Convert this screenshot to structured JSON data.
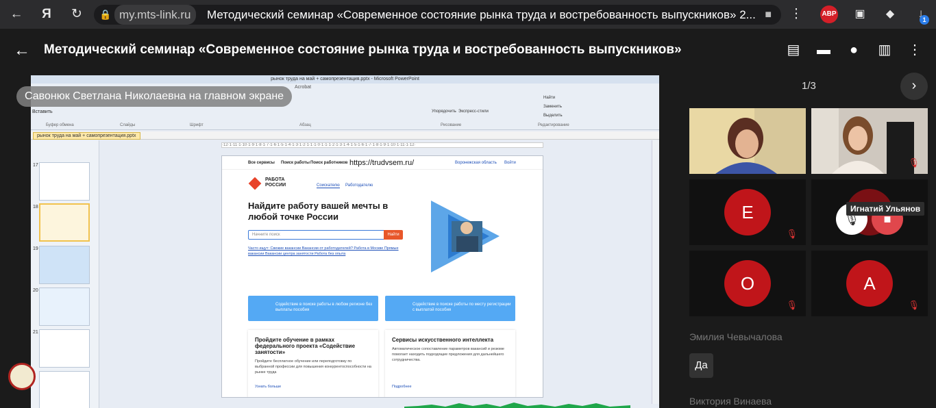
{
  "browser": {
    "url_domain": "my.mts-link.ru",
    "tab_title": "Методический семинар «Современное состояние рынка труда и востребованность выпускников» 2...",
    "abp_label": "ABP",
    "ext_badge": "1"
  },
  "header": {
    "title": "Методический семинар «Современное состояние рынка труда и востребованность выпускников»"
  },
  "presenter_label": "Савонюк Светлана Николаевна на главном экране",
  "ppt": {
    "window_title": "рынок труда на май + самопрезентация.pptx - Microsoft PowerPoint",
    "doc_tab": "рынок труда на май + самопрезентация.pptx",
    "slide_numbers": [
      "17",
      "18",
      "19",
      "20",
      "21"
    ],
    "ribbon": {
      "paste": "Вставить",
      "clipboard": "Буфер обмена",
      "slides": "Слайды",
      "font": "Шрифт",
      "paragraph": "Абзац",
      "drawing": "Рисование",
      "editing": "Редактирование",
      "find": "Найти",
      "replace": "Заменить",
      "select": "Выделить",
      "arrange": "Упорядочить",
      "express": "Экспресс-стили",
      "acrobat": "Acrobat"
    }
  },
  "slide": {
    "nav_services": "Все сервисы",
    "nav_job": "Поиск работы",
    "nav_workers": "Поиск работников",
    "url": "https://trudvsem.ru/",
    "region": "Воронежская область",
    "login": "Войти",
    "brand": "РАБОТА РОССИИ",
    "tab_seeker": "Соискателю",
    "tab_employer": "Работодателю",
    "headline": "Найдите работу вашей мечты в любой точке России",
    "search_placeholder": "Начните поиск",
    "search_button": "Найти",
    "links": "Часто ищут:  Свежие вакансии  Вакансии от работодателей?  Работа в Москве  Прямые вакансии  Вакансии центра занятости  Работа без опыта",
    "box1": "Содействие в поиске работы в любом регионе без выплаты пособия",
    "box2": "Содействие в поиске работы по месту регистрации с выплатой пособия",
    "card1_title": "Пройдите обучение в рамках федерального проекта «Содействие занятости»",
    "card1_text": "Пройдите бесплатное обучение или переподготовку по выбранной профессии для повышения конкурентоспособности на рынке труда",
    "card1_link": "Узнать больше",
    "card2_title": "Сервисы искусственного интеллекта",
    "card2_text": "Автоматическое сопоставление параметров вакансий и резюме помогает находить подходящие предложения для дальнейшего сотрудничества.",
    "card2_link": "Подробнее"
  },
  "side": {
    "pager": "1/3",
    "participants": [
      {
        "initial": "Е"
      },
      {
        "initial": "О"
      },
      {
        "initial": "А"
      }
    ],
    "speaker_name": "Игнатий Ульянов",
    "list": [
      "Эмилия Чевычалова",
      "Виктория Винаева"
    ],
    "yes_button": "Да"
  },
  "colors": {
    "accent": "#c0151a",
    "bg": "#1b1b1b"
  }
}
